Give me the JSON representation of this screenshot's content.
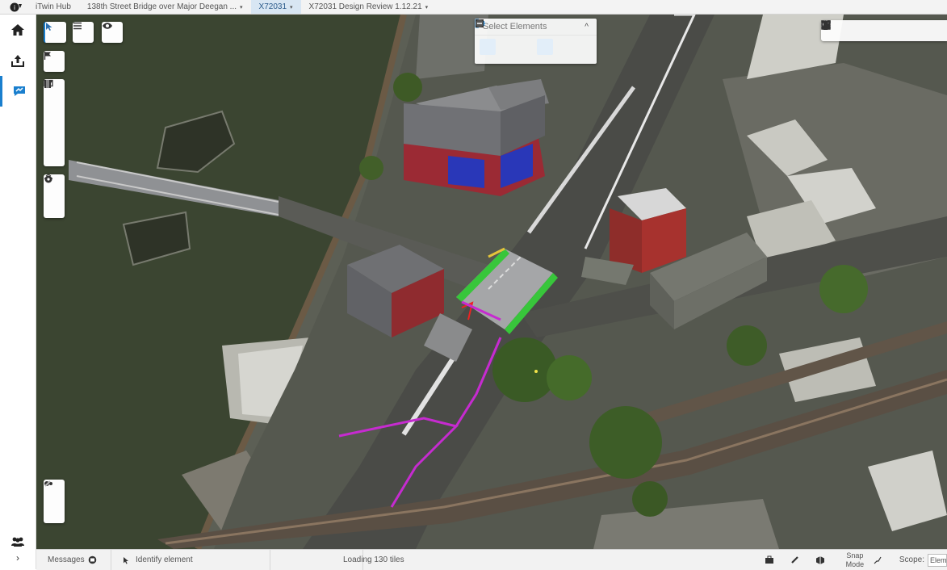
{
  "topbar": {
    "app_name": "iTwin Hub",
    "crumbs": [
      {
        "label": "138th Street Bridge over Major Deegan ...",
        "caret": "▾"
      },
      {
        "label": "X72031",
        "caret": "▾"
      },
      {
        "label": "X72031 Design Review 1.12.21",
        "caret": "▾"
      }
    ]
  },
  "leftrail": {
    "items": [
      "home-icon",
      "upload-icon",
      "issues-icon"
    ],
    "bottom": [
      "people-icon",
      "expand-icon"
    ]
  },
  "select_panel": {
    "title": "Select Elements",
    "collapse": "^"
  },
  "statusbar": {
    "messages_label": "Messages",
    "identify_label": "Identify element",
    "loading_text": "Loading 130 tiles",
    "snap_label": "Snap Mode",
    "scope_label": "Scope:",
    "scope_value": "Elem"
  },
  "colors": {
    "accent": "#1a7fce",
    "highlight_green": "#38c63b",
    "path_magenta": "#c62bd0",
    "river": "#3b4531"
  }
}
